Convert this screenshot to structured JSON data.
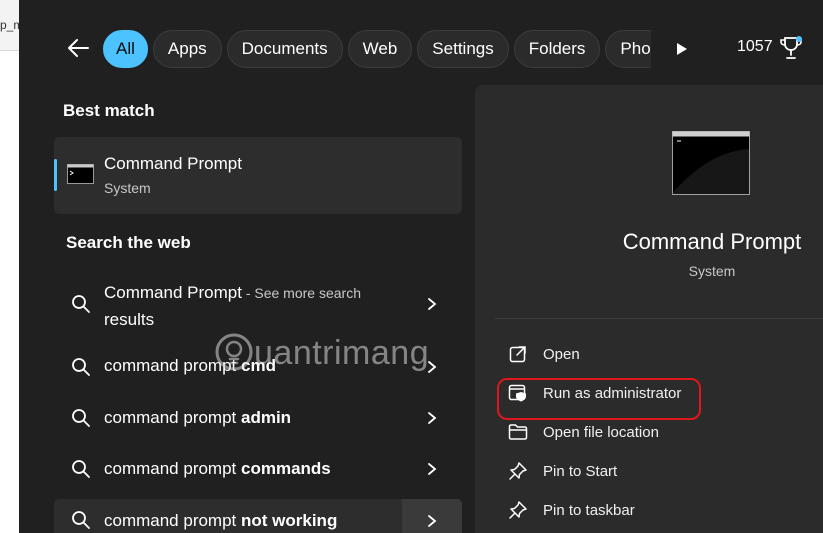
{
  "background": {
    "tab_text": "p_m"
  },
  "topbar": {
    "filters": [
      "All",
      "Apps",
      "Documents",
      "Web",
      "Settings",
      "Folders",
      "Pho"
    ],
    "points": "1057"
  },
  "left": {
    "best_match_title": "Best match",
    "best_match": {
      "name": "Command Prompt",
      "type": "System"
    },
    "search_web_title": "Search the web",
    "web_results": [
      {
        "plain": "Command Prompt",
        "bold": "",
        "suffix": " - See more search",
        "suffix2": "results"
      },
      {
        "plain": "command prompt ",
        "bold": "cmd"
      },
      {
        "plain": "command prompt ",
        "bold": "admin"
      },
      {
        "plain": "command prompt ",
        "bold": "commands"
      },
      {
        "plain": "command prompt ",
        "bold": "not working"
      }
    ]
  },
  "right": {
    "title": "Command Prompt",
    "subtitle": "System",
    "actions": [
      {
        "label": "Open",
        "icon": "open-icon"
      },
      {
        "label": "Run as administrator",
        "icon": "shield-admin-icon"
      },
      {
        "label": "Open file location",
        "icon": "folder-icon"
      },
      {
        "label": "Pin to Start",
        "icon": "pin-icon"
      },
      {
        "label": "Pin to taskbar",
        "icon": "pin-icon"
      }
    ]
  },
  "watermark": {
    "text": "uantrimang"
  },
  "colors": {
    "accent": "#4cc2ff",
    "highlight": "#e0161c",
    "panel": "#202020"
  }
}
